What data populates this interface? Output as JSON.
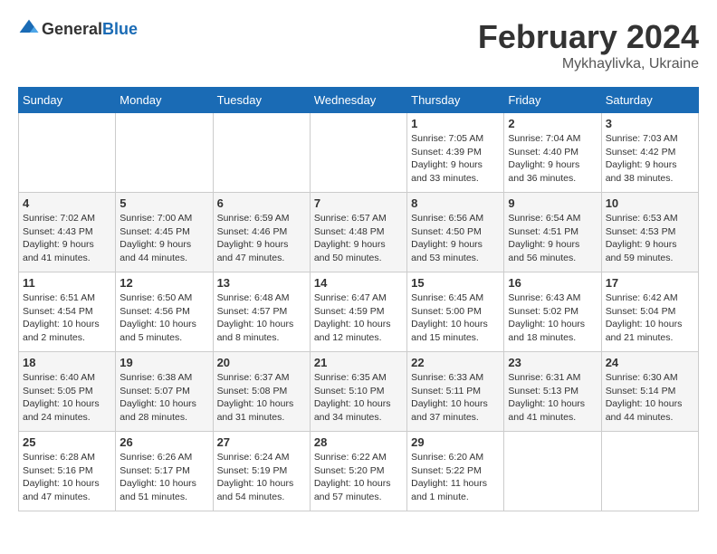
{
  "header": {
    "logo_general": "General",
    "logo_blue": "Blue",
    "month_year": "February 2024",
    "location": "Mykhaylivka, Ukraine"
  },
  "weekdays": [
    "Sunday",
    "Monday",
    "Tuesday",
    "Wednesday",
    "Thursday",
    "Friday",
    "Saturday"
  ],
  "weeks": [
    [
      {
        "day": "",
        "info": ""
      },
      {
        "day": "",
        "info": ""
      },
      {
        "day": "",
        "info": ""
      },
      {
        "day": "",
        "info": ""
      },
      {
        "day": "1",
        "info": "Sunrise: 7:05 AM\nSunset: 4:39 PM\nDaylight: 9 hours\nand 33 minutes."
      },
      {
        "day": "2",
        "info": "Sunrise: 7:04 AM\nSunset: 4:40 PM\nDaylight: 9 hours\nand 36 minutes."
      },
      {
        "day": "3",
        "info": "Sunrise: 7:03 AM\nSunset: 4:42 PM\nDaylight: 9 hours\nand 38 minutes."
      }
    ],
    [
      {
        "day": "4",
        "info": "Sunrise: 7:02 AM\nSunset: 4:43 PM\nDaylight: 9 hours\nand 41 minutes."
      },
      {
        "day": "5",
        "info": "Sunrise: 7:00 AM\nSunset: 4:45 PM\nDaylight: 9 hours\nand 44 minutes."
      },
      {
        "day": "6",
        "info": "Sunrise: 6:59 AM\nSunset: 4:46 PM\nDaylight: 9 hours\nand 47 minutes."
      },
      {
        "day": "7",
        "info": "Sunrise: 6:57 AM\nSunset: 4:48 PM\nDaylight: 9 hours\nand 50 minutes."
      },
      {
        "day": "8",
        "info": "Sunrise: 6:56 AM\nSunset: 4:50 PM\nDaylight: 9 hours\nand 53 minutes."
      },
      {
        "day": "9",
        "info": "Sunrise: 6:54 AM\nSunset: 4:51 PM\nDaylight: 9 hours\nand 56 minutes."
      },
      {
        "day": "10",
        "info": "Sunrise: 6:53 AM\nSunset: 4:53 PM\nDaylight: 9 hours\nand 59 minutes."
      }
    ],
    [
      {
        "day": "11",
        "info": "Sunrise: 6:51 AM\nSunset: 4:54 PM\nDaylight: 10 hours\nand 2 minutes."
      },
      {
        "day": "12",
        "info": "Sunrise: 6:50 AM\nSunset: 4:56 PM\nDaylight: 10 hours\nand 5 minutes."
      },
      {
        "day": "13",
        "info": "Sunrise: 6:48 AM\nSunset: 4:57 PM\nDaylight: 10 hours\nand 8 minutes."
      },
      {
        "day": "14",
        "info": "Sunrise: 6:47 AM\nSunset: 4:59 PM\nDaylight: 10 hours\nand 12 minutes."
      },
      {
        "day": "15",
        "info": "Sunrise: 6:45 AM\nSunset: 5:00 PM\nDaylight: 10 hours\nand 15 minutes."
      },
      {
        "day": "16",
        "info": "Sunrise: 6:43 AM\nSunset: 5:02 PM\nDaylight: 10 hours\nand 18 minutes."
      },
      {
        "day": "17",
        "info": "Sunrise: 6:42 AM\nSunset: 5:04 PM\nDaylight: 10 hours\nand 21 minutes."
      }
    ],
    [
      {
        "day": "18",
        "info": "Sunrise: 6:40 AM\nSunset: 5:05 PM\nDaylight: 10 hours\nand 24 minutes."
      },
      {
        "day": "19",
        "info": "Sunrise: 6:38 AM\nSunset: 5:07 PM\nDaylight: 10 hours\nand 28 minutes."
      },
      {
        "day": "20",
        "info": "Sunrise: 6:37 AM\nSunset: 5:08 PM\nDaylight: 10 hours\nand 31 minutes."
      },
      {
        "day": "21",
        "info": "Sunrise: 6:35 AM\nSunset: 5:10 PM\nDaylight: 10 hours\nand 34 minutes."
      },
      {
        "day": "22",
        "info": "Sunrise: 6:33 AM\nSunset: 5:11 PM\nDaylight: 10 hours\nand 37 minutes."
      },
      {
        "day": "23",
        "info": "Sunrise: 6:31 AM\nSunset: 5:13 PM\nDaylight: 10 hours\nand 41 minutes."
      },
      {
        "day": "24",
        "info": "Sunrise: 6:30 AM\nSunset: 5:14 PM\nDaylight: 10 hours\nand 44 minutes."
      }
    ],
    [
      {
        "day": "25",
        "info": "Sunrise: 6:28 AM\nSunset: 5:16 PM\nDaylight: 10 hours\nand 47 minutes."
      },
      {
        "day": "26",
        "info": "Sunrise: 6:26 AM\nSunset: 5:17 PM\nDaylight: 10 hours\nand 51 minutes."
      },
      {
        "day": "27",
        "info": "Sunrise: 6:24 AM\nSunset: 5:19 PM\nDaylight: 10 hours\nand 54 minutes."
      },
      {
        "day": "28",
        "info": "Sunrise: 6:22 AM\nSunset: 5:20 PM\nDaylight: 10 hours\nand 57 minutes."
      },
      {
        "day": "29",
        "info": "Sunrise: 6:20 AM\nSunset: 5:22 PM\nDaylight: 11 hours\nand 1 minute."
      },
      {
        "day": "",
        "info": ""
      },
      {
        "day": "",
        "info": ""
      }
    ]
  ]
}
